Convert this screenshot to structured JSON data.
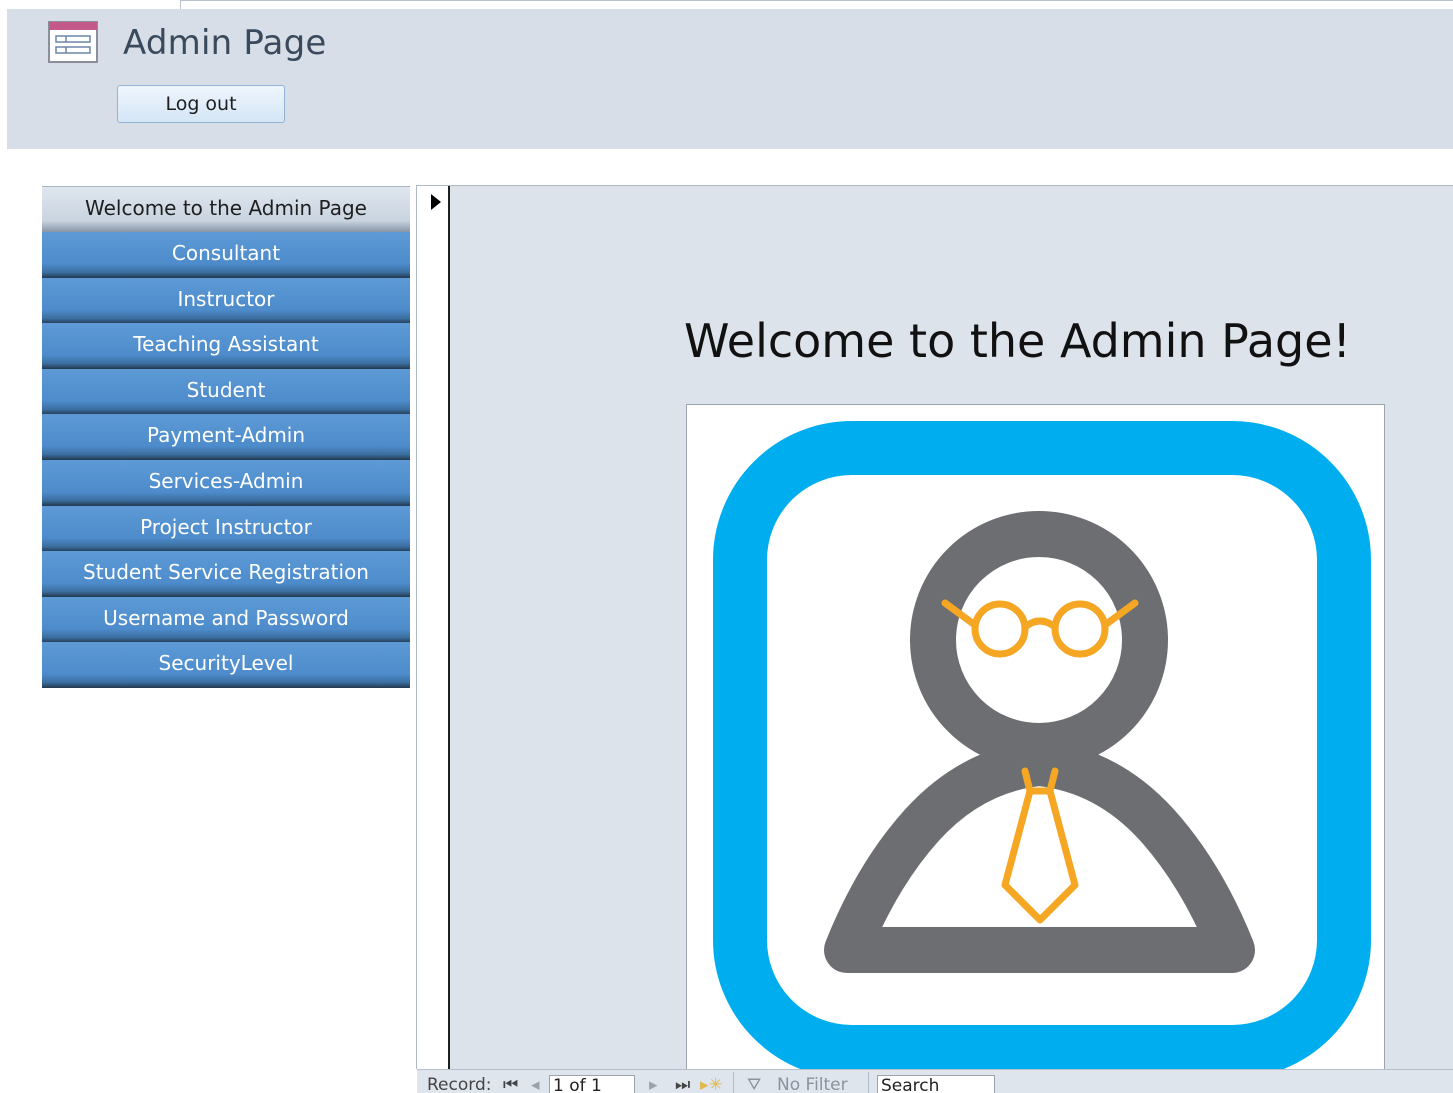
{
  "header": {
    "title": "Admin Page",
    "logout_label": "Log out"
  },
  "nav": {
    "items": [
      {
        "label": "Welcome to the Admin Page"
      },
      {
        "label": "Consultant"
      },
      {
        "label": "Instructor"
      },
      {
        "label": "Teaching Assistant"
      },
      {
        "label": "Student"
      },
      {
        "label": "Payment-Admin"
      },
      {
        "label": "Services-Admin"
      },
      {
        "label": "Project Instructor"
      },
      {
        "label": "Student Service Registration"
      },
      {
        "label": "Username and Password"
      },
      {
        "label": "SecurityLevel"
      }
    ]
  },
  "main": {
    "welcome_text": "Welcome to the Admin Page!",
    "picture_icon": "admin-person-icon"
  },
  "status_bar": {
    "record_label": "Record:",
    "record_value": "1 of 1",
    "filter_label": "No Filter",
    "search_value": "Search"
  },
  "colors": {
    "header_bg": "#d7dee7",
    "nav_blue": "#4d8bcb",
    "icon_ring_blue": "#00aeef",
    "icon_gray": "#6d6e71",
    "icon_orange": "#f5a623"
  }
}
